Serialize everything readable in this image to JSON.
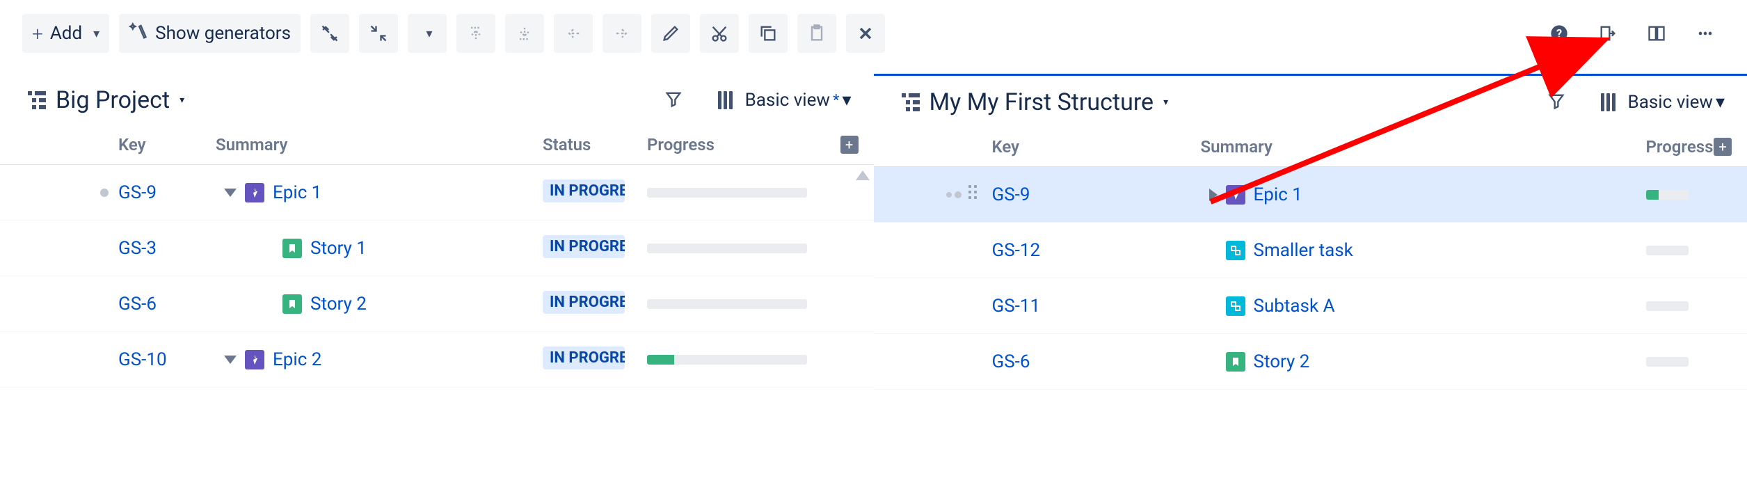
{
  "toolbar": {
    "add_label": "Add",
    "generators_label": "Show generators"
  },
  "left": {
    "title": "Big Project",
    "view_label": "Basic view",
    "columns": {
      "key": "Key",
      "summary": "Summary",
      "status": "Status",
      "progress": "Progress"
    },
    "rows": [
      {
        "key": "GS-9",
        "summary": "Epic 1",
        "type": "epic",
        "indent": 0,
        "expander": "open",
        "status": "IN PROGRESS",
        "progress": 0
      },
      {
        "key": "GS-3",
        "summary": "Story 1",
        "type": "story",
        "indent": 60,
        "expander": "none",
        "status": "IN PROGRESS",
        "progress": 0
      },
      {
        "key": "GS-6",
        "summary": "Story 2",
        "type": "story",
        "indent": 60,
        "expander": "none",
        "status": "IN PROGRESS",
        "progress": 0
      },
      {
        "key": "GS-10",
        "summary": "Epic 2",
        "type": "epic",
        "indent": 0,
        "expander": "open",
        "status": "IN PROGRESS",
        "progress": 17
      }
    ]
  },
  "right": {
    "title": "My My First Structure",
    "view_label": "Basic view",
    "columns": {
      "key": "Key",
      "summary": "Summary",
      "progress": "Progress"
    },
    "rows": [
      {
        "key": "GS-9",
        "summary": "Epic 1",
        "type": "epic",
        "indent": 0,
        "expander": "closed",
        "selected": true,
        "progress": 30
      },
      {
        "key": "GS-12",
        "summary": "Smaller task",
        "type": "sub",
        "indent": 0,
        "expander": "none",
        "progress": 0
      },
      {
        "key": "GS-11",
        "summary": "Subtask A",
        "type": "sub",
        "indent": 0,
        "expander": "none",
        "progress": 0
      },
      {
        "key": "GS-6",
        "summary": "Story 2",
        "type": "story",
        "indent": 0,
        "expander": "none",
        "progress": 0
      }
    ]
  }
}
